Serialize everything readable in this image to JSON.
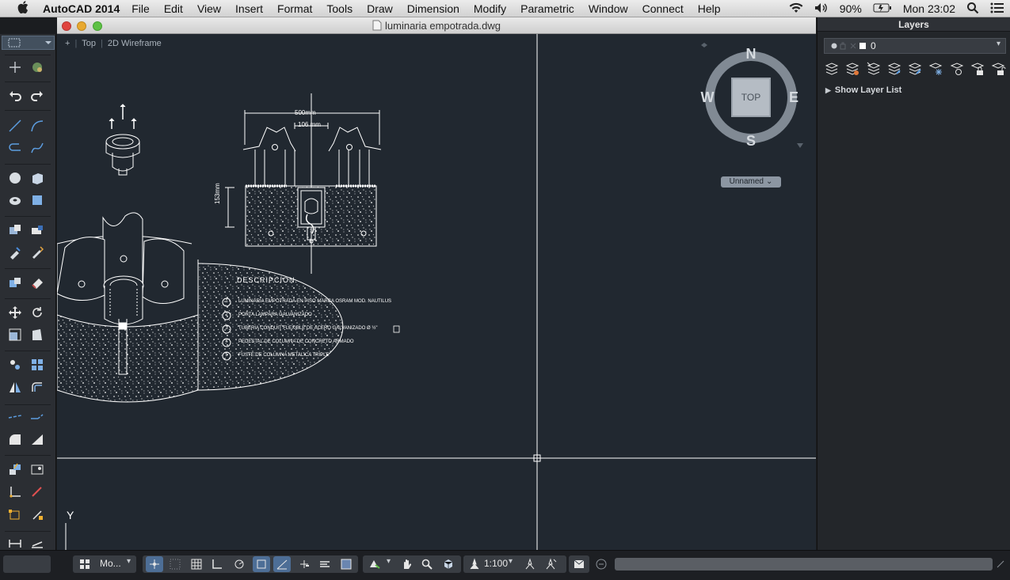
{
  "menubar": {
    "app_name": "AutoCAD 2014",
    "items": [
      "File",
      "Edit",
      "View",
      "Insert",
      "Format",
      "Tools",
      "Draw",
      "Dimension",
      "Modify",
      "Parametric",
      "Window",
      "Connect",
      "Help"
    ],
    "battery": "90%",
    "clock": "Mon 23:02"
  },
  "document": {
    "title": "luminaria empotrada.dwg",
    "viewport_label_plus": "+",
    "viewport_view": "Top",
    "viewport_style": "2D Wireframe"
  },
  "viewcube": {
    "face": "TOP",
    "north": "N",
    "south": "S",
    "east": "E",
    "west": "W",
    "ucs_menu": "Unnamed"
  },
  "drawing": {
    "dim_total": "500mm",
    "dim_inner": "106 mm",
    "dim_height": "153mm",
    "section_title": "DESCRIPCION",
    "items": [
      {
        "num": "1",
        "text": "LUMINARIA EMPOTRADA EN PISO MARCA OSRAM MOD. NAUTILUS"
      },
      {
        "num": "2",
        "text": "PORTA LAMPARA GALVANIZADO"
      },
      {
        "num": "3",
        "text": "TUBERIA CONDUIT FLEXIBLE DE ACERO GALVANIZADO Ø ½\""
      },
      {
        "num": "4",
        "text": "PEDESTAL DE COLUMNA DE CONCRETO ARMADO"
      },
      {
        "num": "5",
        "text": "FUSTE DE COLUMNA METALICA TRIPLE"
      }
    ],
    "ucs_y": "Y"
  },
  "layers": {
    "title": "Layers",
    "current_layer": "0",
    "show_list": "Show Layer List"
  },
  "statusbar": {
    "model_label": "Mo...",
    "scale": "1:100"
  },
  "colors": {
    "canvas": "#212830",
    "lines": "#ffffff",
    "panel": "#2b2e33"
  }
}
